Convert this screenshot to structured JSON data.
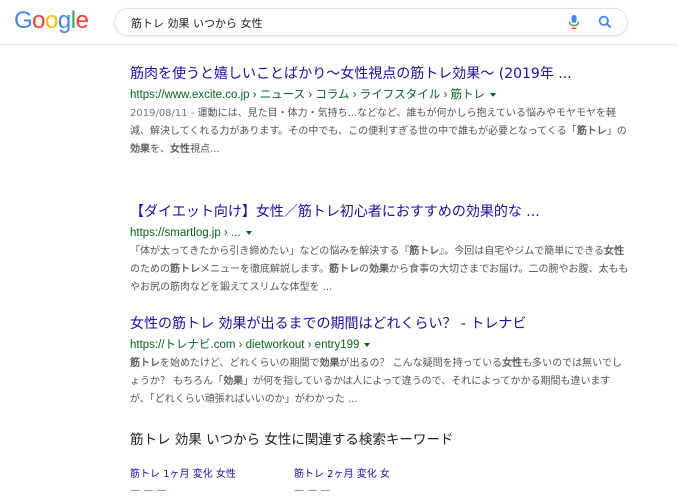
{
  "logo": {
    "text": "Google",
    "letters": [
      "G",
      "o",
      "o",
      "g",
      "l",
      "e"
    ],
    "colors": [
      "#4285F4",
      "#EA4335",
      "#FBBC05",
      "#4285F4",
      "#34A853",
      "#EA4335"
    ]
  },
  "search": {
    "query": "筋トレ 効果 いつから 女性"
  },
  "results": [
    {
      "title": "筋肉を使うと嬉しいことばかり～女性視点の筋トレ効果～ (2019年 ...",
      "url": "https://www.excite.co.jp › ニュース › コラム › ライフスタイル › 筋トレ",
      "date": "2019/08/11 - ",
      "snippet": "運動には、見た目・体力・気持ち...などなど、誰もが何かしら抱えている悩みやモヤモヤを軽減、解決してくれる力があります。その中でも、この便利すぎる世の中で誰もが必要となってくる「筋トレ」の効果を、女性視点..."
    },
    {
      "title": "【ダイエット向け】女性／筋トレ初心者におすすめの効果的な ...",
      "url": "https://smartlog.jp › ...",
      "date": "",
      "snippet": "「体が太ってきたから引き締めたい」などの悩みを解決する『筋トレ』。今回は自宅やジムで簡単にできる女性のための筋トレメニューを徹底解説します。筋トレの効果から食事の大切さまでお届け。二の腕やお腹、太ももやお尻の筋肉などを鍛えてスリムな体型を ..."
    },
    {
      "title": "女性の筋トレ 効果が出るまでの期間はどれくらい？ - トレナビ",
      "url": "https://トレナビ.com › dietworkout › entry199",
      "date": "",
      "snippet": "筋トレを始めたけど、どれくらいの期間で効果が出るの？ こんな疑問を持っている女性も多いのでは無いでしょうか？ もちろん「効果」が何を指しているかは人によって違うので、それによってかかる期間も違いますが、「どれくらい頑張ればいいのか」がわかった ..."
    }
  ],
  "related": {
    "heading": "筋トレ 効果 いつから 女性に関連する検索キーワード",
    "links": [
      "筋トレ 1ヶ月 変化 女性",
      "筋トレ 2ヶ月 変化 女"
    ],
    "more": [
      "— — —",
      "— — —"
    ]
  }
}
